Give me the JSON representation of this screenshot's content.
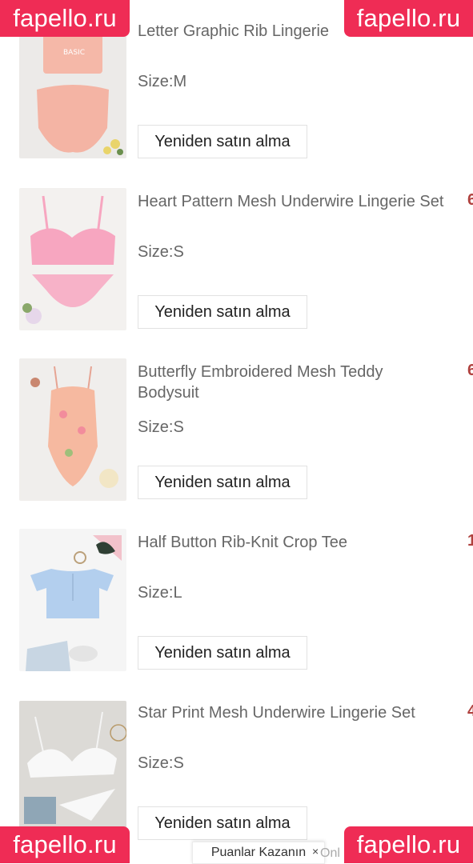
{
  "watermark": {
    "text": "fapello.ru"
  },
  "rebuy_label": "Yeniden satın alma",
  "items": [
    {
      "title": "Letter Graphic Rib Lingerie",
      "size": "Size:M",
      "price_fragment": "",
      "image": "pink-lingerie-set-image"
    },
    {
      "title": "Heart Pattern Mesh Underwire Lingerie Set",
      "size": "Size:S",
      "price_fragment": "6",
      "image": "pink-mesh-lingerie-image"
    },
    {
      "title": "Butterfly Embroidered Mesh Teddy Bodysuit",
      "size": "Size:S",
      "price_fragment": "6",
      "image": "floral-bodysuit-image"
    },
    {
      "title": "Half Button Rib-Knit Crop Tee",
      "size": "Size:L",
      "price_fragment": "1",
      "image": "blue-crop-tee-image"
    },
    {
      "title": "Star Print Mesh Underwire Lingerie Set",
      "size": "Size:S",
      "price_fragment": "4",
      "image": "white-lace-lingerie-image"
    }
  ],
  "points_bar": {
    "label": "Puanlar Kazanın",
    "close": "×",
    "extra": "Onl"
  },
  "colors": {
    "watermark": "#ef2c55",
    "price": "#b0413e",
    "text": "#666666"
  }
}
